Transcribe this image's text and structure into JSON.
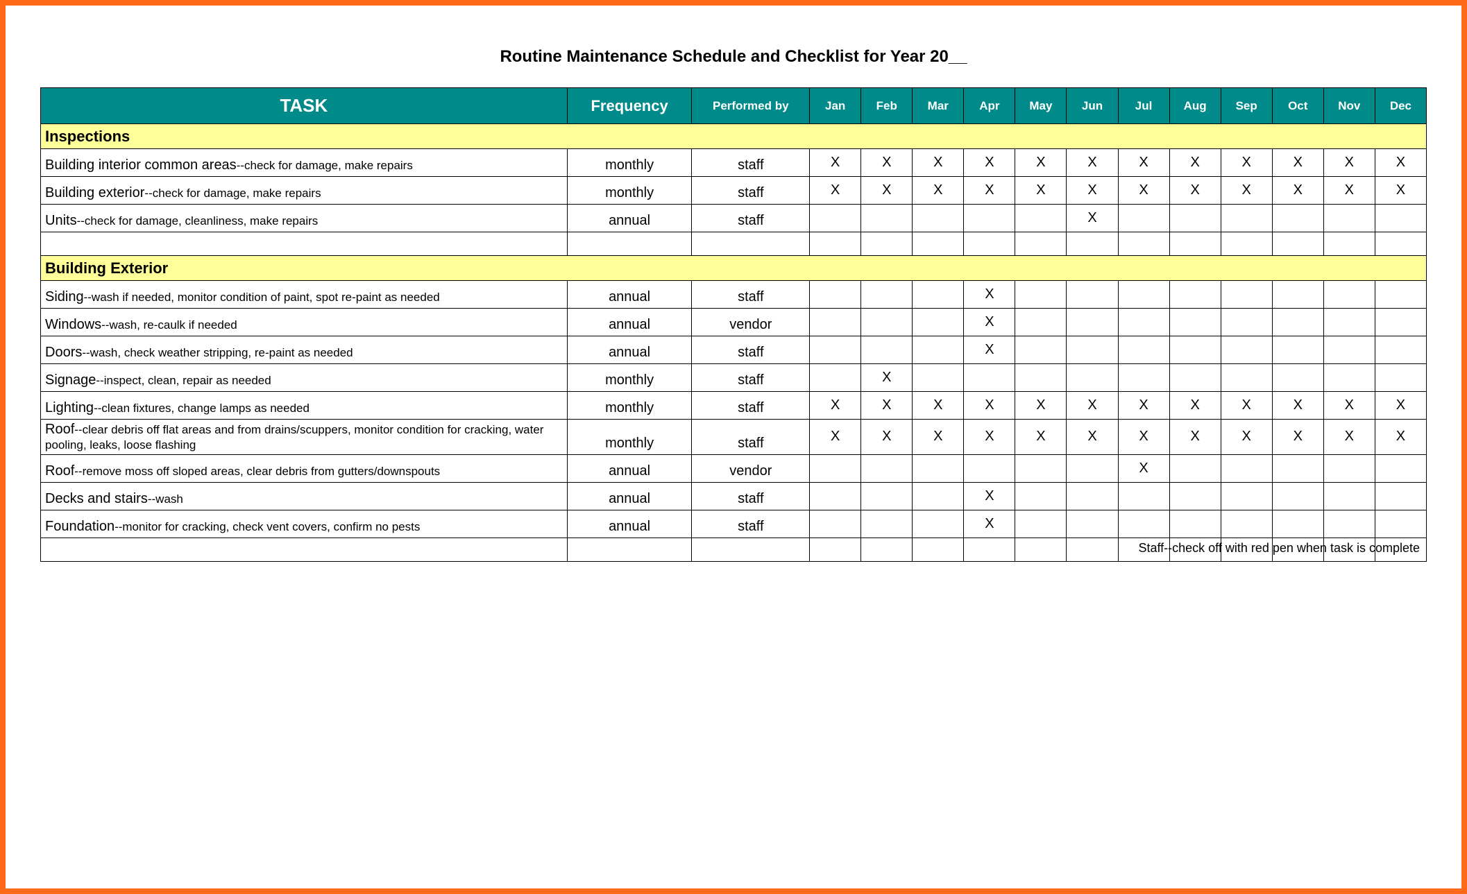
{
  "title": "Routine Maintenance Schedule and Checklist for Year 20__",
  "headers": {
    "task": "TASK",
    "frequency": "Frequency",
    "performed_by": "Performed by",
    "months": [
      "Jan",
      "Feb",
      "Mar",
      "Apr",
      "May",
      "Jun",
      "Jul",
      "Aug",
      "Sep",
      "Oct",
      "Nov",
      "Dec"
    ]
  },
  "sections": [
    {
      "title": "Inspections",
      "rows": [
        {
          "name": "Building interior common areas",
          "desc": "--check for damage, make repairs",
          "frequency": "monthly",
          "performed_by": "staff",
          "months": [
            "X",
            "X",
            "X",
            "X",
            "X",
            "X",
            "X",
            "X",
            "X",
            "X",
            "X",
            "X"
          ]
        },
        {
          "name": "Building exterior",
          "desc": "--check for damage, make repairs",
          "frequency": "monthly",
          "performed_by": "staff",
          "months": [
            "X",
            "X",
            "X",
            "X",
            "X",
            "X",
            "X",
            "X",
            "X",
            "X",
            "X",
            "X"
          ]
        },
        {
          "name": "Units",
          "desc": "--check for damage, cleanliness, make repairs",
          "frequency": "annual",
          "performed_by": "staff",
          "months": [
            "",
            "",
            "",
            "",
            "",
            "X",
            "",
            "",
            "",
            "",
            "",
            ""
          ]
        }
      ],
      "trailing_blank": true
    },
    {
      "title": "Building Exterior",
      "rows": [
        {
          "name": "Siding",
          "desc": "--wash if needed, monitor condition of paint, spot re-paint as needed",
          "frequency": "annual",
          "performed_by": "staff",
          "months": [
            "",
            "",
            "",
            "X",
            "",
            "",
            "",
            "",
            "",
            "",
            "",
            ""
          ]
        },
        {
          "name": "Windows",
          "desc": "--wash, re-caulk if needed",
          "frequency": "annual",
          "performed_by": "vendor",
          "months": [
            "",
            "",
            "",
            "X",
            "",
            "",
            "",
            "",
            "",
            "",
            "",
            ""
          ]
        },
        {
          "name": "Doors",
          "desc": "--wash, check weather stripping, re-paint as needed",
          "frequency": "annual",
          "performed_by": "staff",
          "months": [
            "",
            "",
            "",
            "X",
            "",
            "",
            "",
            "",
            "",
            "",
            "",
            ""
          ]
        },
        {
          "name": "Signage",
          "desc": "--inspect, clean, repair as needed",
          "frequency": "monthly",
          "performed_by": "staff",
          "months": [
            "",
            "X",
            "",
            "",
            "",
            "",
            "",
            "",
            "",
            "",
            "",
            ""
          ]
        },
        {
          "name": "Lighting",
          "desc": "--clean fixtures, change lamps as needed",
          "frequency": "monthly",
          "performed_by": "staff",
          "months": [
            "X",
            "X",
            "X",
            "X",
            "X",
            "X",
            "X",
            "X",
            "X",
            "X",
            "X",
            "X"
          ]
        },
        {
          "name": "Roof",
          "desc": "--clear debris off flat areas and from drains/scuppers, monitor condition for cracking, water pooling, leaks, loose flashing",
          "frequency": "monthly",
          "performed_by": "staff",
          "months": [
            "X",
            "X",
            "X",
            "X",
            "X",
            "X",
            "X",
            "X",
            "X",
            "X",
            "X",
            "X"
          ],
          "multi": true
        },
        {
          "name": "Roof",
          "desc": "--remove moss off sloped areas, clear debris from gutters/downspouts",
          "frequency": "annual",
          "performed_by": "vendor",
          "months": [
            "",
            "",
            "",
            "",
            "",
            "",
            "X",
            "",
            "",
            "",
            "",
            ""
          ]
        },
        {
          "name": "Decks and stairs",
          "desc": "--wash",
          "frequency": "annual",
          "performed_by": "staff",
          "months": [
            "",
            "",
            "",
            "X",
            "",
            "",
            "",
            "",
            "",
            "",
            "",
            ""
          ]
        },
        {
          "name": "Foundation",
          "desc": "--monitor for cracking, check vent covers, confirm no pests",
          "frequency": "annual",
          "performed_by": "staff",
          "months": [
            "",
            "",
            "",
            "X",
            "",
            "",
            "",
            "",
            "",
            "",
            "",
            ""
          ]
        }
      ],
      "trailing_blank": true
    }
  ],
  "footer_note": "Staff--check off with red pen when task is complete"
}
